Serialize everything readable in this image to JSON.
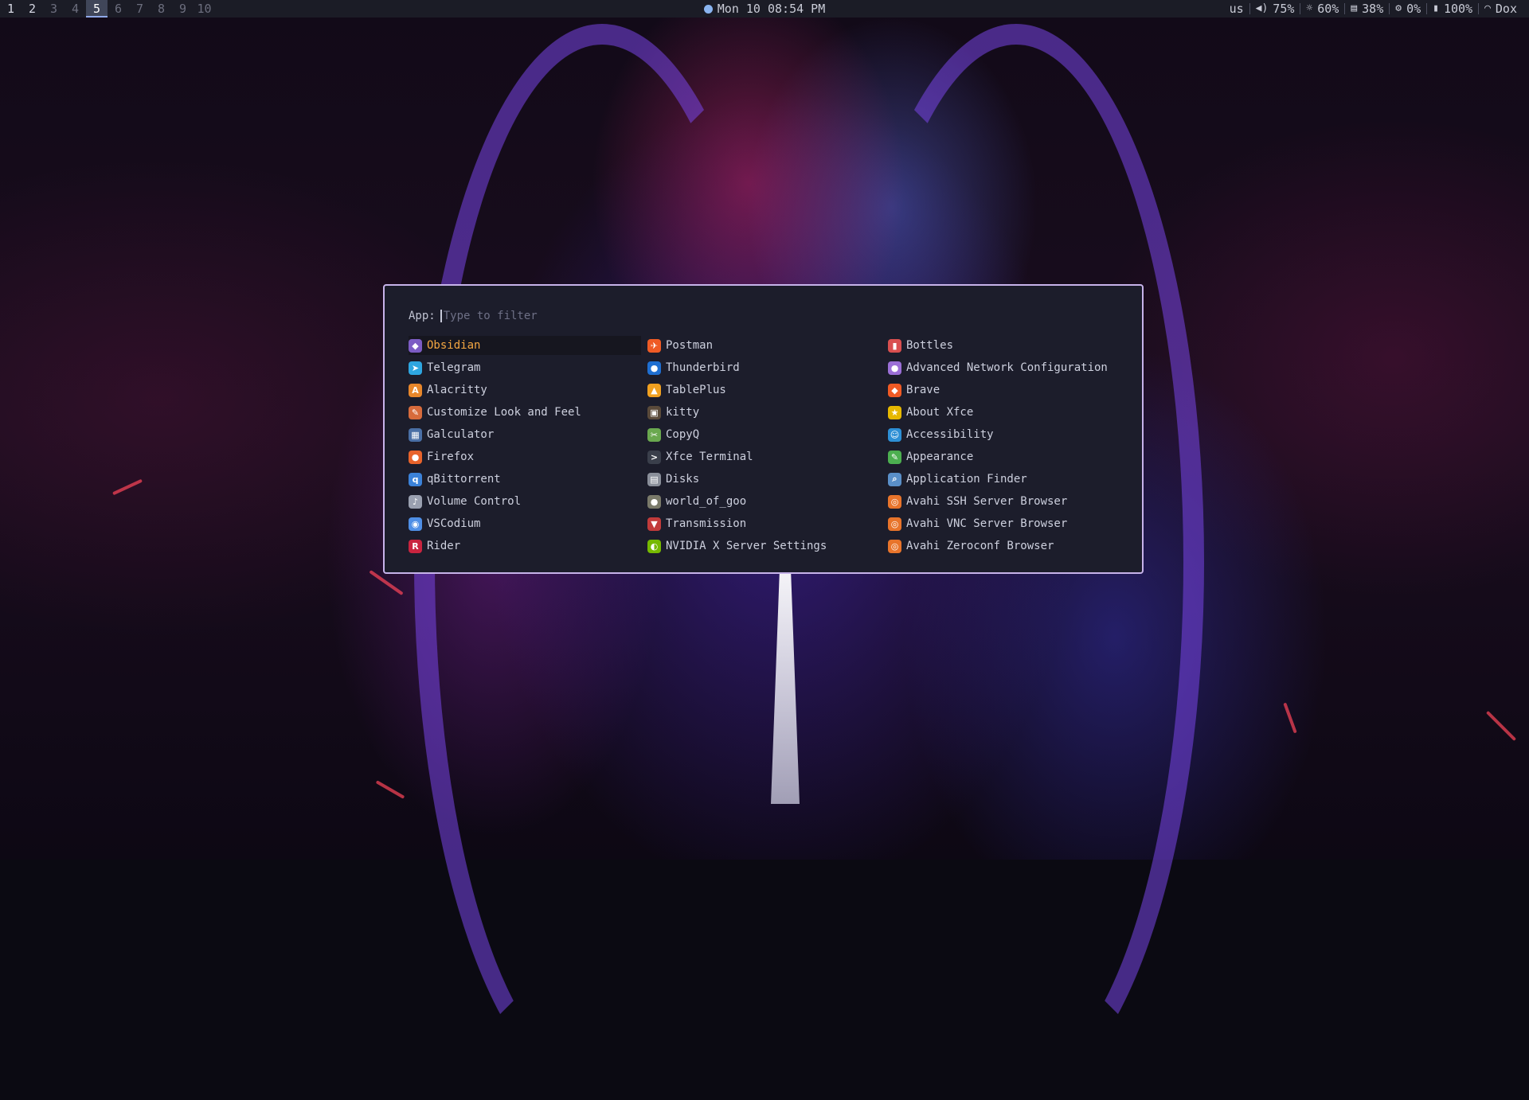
{
  "topbar": {
    "workspaces": [
      "1",
      "2",
      "3",
      "4",
      "5",
      "6",
      "7",
      "8",
      "9",
      "10"
    ],
    "active_workspace": "5",
    "clock": "Mon 10 08:54 PM",
    "layout": "us",
    "volume": "75%",
    "brightness": "60%",
    "memory": "38%",
    "cpu": "0%",
    "battery": "100%",
    "network": "Dox"
  },
  "launcher": {
    "prompt_label": "App:",
    "placeholder": "Type to filter",
    "columns": [
      [
        {
          "label": "Obsidian",
          "icon": "obsidian-icon",
          "color": "#7c5cc4",
          "glyph": "◆",
          "selected": true
        },
        {
          "label": "Telegram",
          "icon": "telegram-icon",
          "color": "#2ea6e0",
          "glyph": "➤"
        },
        {
          "label": "Alacritty",
          "icon": "alacritty-icon",
          "color": "#e8872b",
          "glyph": "A"
        },
        {
          "label": "Customize Look and Feel",
          "icon": "customize-icon",
          "color": "#d76b3c",
          "glyph": "✎"
        },
        {
          "label": "Galculator",
          "icon": "calculator-icon",
          "color": "#4a6fa5",
          "glyph": "▦"
        },
        {
          "label": "Firefox",
          "icon": "firefox-icon",
          "color": "#e8632b",
          "glyph": "●"
        },
        {
          "label": "qBittorrent",
          "icon": "qbittorrent-icon",
          "color": "#3b82d9",
          "glyph": "q"
        },
        {
          "label": "Volume Control",
          "icon": "volume-icon",
          "color": "#9aa0b0",
          "glyph": "♪"
        },
        {
          "label": "VSCodium",
          "icon": "vscodium-icon",
          "color": "#4f8fe6",
          "glyph": "◉"
        },
        {
          "label": "Rider",
          "icon": "rider-icon",
          "color": "#c9243f",
          "glyph": "R"
        }
      ],
      [
        {
          "label": "Postman",
          "icon": "postman-icon",
          "color": "#ef5b25",
          "glyph": "✈"
        },
        {
          "label": "Thunderbird",
          "icon": "thunderbird-icon",
          "color": "#1f6fd1",
          "glyph": "●"
        },
        {
          "label": "TablePlus",
          "icon": "tableplus-icon",
          "color": "#f0a020",
          "glyph": "▲"
        },
        {
          "label": "kitty",
          "icon": "kitty-icon",
          "color": "#5a4a3a",
          "glyph": "▣"
        },
        {
          "label": "CopyQ",
          "icon": "copyq-icon",
          "color": "#6aa84f",
          "glyph": "✂"
        },
        {
          "label": "Xfce Terminal",
          "icon": "terminal-icon",
          "color": "#3a3f4b",
          "glyph": ">"
        },
        {
          "label": "Disks",
          "icon": "disks-icon",
          "color": "#8a8f9a",
          "glyph": "▤"
        },
        {
          "label": "world_of_goo",
          "icon": "world-of-goo-icon",
          "color": "#7a7a6a",
          "glyph": "●"
        },
        {
          "label": "Transmission",
          "icon": "transmission-icon",
          "color": "#c23b3b",
          "glyph": "▼"
        },
        {
          "label": "NVIDIA X Server Settings",
          "icon": "nvidia-icon",
          "color": "#76b900",
          "glyph": "◐"
        }
      ],
      [
        {
          "label": "Bottles",
          "icon": "bottles-icon",
          "color": "#d94f4f",
          "glyph": "▮"
        },
        {
          "label": "Advanced Network Configuration",
          "icon": "network-config-icon",
          "color": "#9b6fd6",
          "glyph": "●"
        },
        {
          "label": "Brave",
          "icon": "brave-icon",
          "color": "#f05a24",
          "glyph": "◆"
        },
        {
          "label": "About Xfce",
          "icon": "about-xfce-icon",
          "color": "#e6b800",
          "glyph": "★"
        },
        {
          "label": "Accessibility",
          "icon": "accessibility-icon",
          "color": "#2d8fd5",
          "glyph": "☺"
        },
        {
          "label": "Appearance",
          "icon": "appearance-icon",
          "color": "#4caf50",
          "glyph": "✎"
        },
        {
          "label": "Application Finder",
          "icon": "app-finder-icon",
          "color": "#5a8fc8",
          "glyph": "⌕"
        },
        {
          "label": "Avahi SSH Server Browser",
          "icon": "avahi-ssh-icon",
          "color": "#e8742b",
          "glyph": "◎"
        },
        {
          "label": "Avahi VNC Server Browser",
          "icon": "avahi-vnc-icon",
          "color": "#e8742b",
          "glyph": "◎"
        },
        {
          "label": "Avahi Zeroconf Browser",
          "icon": "avahi-zeroconf-icon",
          "color": "#e8742b",
          "glyph": "◎"
        }
      ]
    ]
  }
}
